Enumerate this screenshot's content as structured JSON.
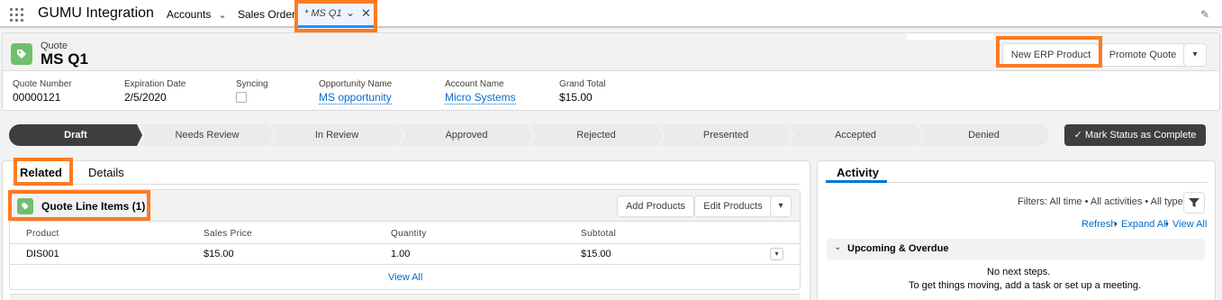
{
  "nav": {
    "app_name": "GUMU Integration",
    "items": [
      {
        "label": "Accounts",
        "chevron": "⌄"
      },
      {
        "label": "Sales Orders"
      }
    ],
    "active_tab": {
      "label": "* MS Q1",
      "chevron": "⌄",
      "close": "✕"
    },
    "edit_icon": "✎"
  },
  "record": {
    "object_type": "Quote",
    "title": "MS Q1",
    "icon": "tag-icon",
    "buttons": {
      "new_erp_product": "New ERP Product",
      "promote_quote": "Promote Quote",
      "more": "▾"
    },
    "fields": {
      "quote_number": {
        "label": "Quote Number",
        "value": "00000121"
      },
      "expiration_date": {
        "label": "Expiration Date",
        "value": "2/5/2020"
      },
      "syncing": {
        "label": "Syncing",
        "checked": false
      },
      "opportunity_name": {
        "label": "Opportunity Name",
        "value": "MS opportunity"
      },
      "account_name": {
        "label": "Account Name",
        "value": "Micro Systems"
      },
      "grand_total": {
        "label": "Grand Total",
        "value": "$15.00"
      }
    }
  },
  "path": {
    "steps": [
      "Draft",
      "Needs Review",
      "In Review",
      "Approved",
      "Rejected",
      "Presented",
      "Accepted",
      "Denied"
    ],
    "current": "Draft",
    "mark_button": "Mark Status as Complete",
    "mark_icon": "✓"
  },
  "tabs": {
    "related": "Related",
    "details": "Details"
  },
  "related_list": {
    "title": "Quote Line Items (1)",
    "buttons": {
      "add": "Add Products",
      "edit": "Edit Products",
      "more": "▾"
    },
    "columns": [
      "Product",
      "Sales Price",
      "Quantity",
      "Subtotal"
    ],
    "rows": [
      {
        "product": "DIS001",
        "sales_price": "$15.00",
        "quantity": "1.00",
        "subtotal": "$15.00"
      }
    ],
    "view_all": "View All"
  },
  "activity": {
    "tab": "Activity",
    "filters": "Filters: All time • All activities • All types",
    "refresh": "Refresh",
    "expand_all": "Expand All",
    "view_all": "View All",
    "upcoming": "Upcoming & Overdue",
    "no_steps": "No next steps.",
    "hint": "To get things moving, add a task or set up a meeting."
  },
  "colors": {
    "accent": "#ff7a22",
    "brand": "#0176d3",
    "quote_icon": "#6ec06e",
    "path_current": "#3e3e3c"
  }
}
